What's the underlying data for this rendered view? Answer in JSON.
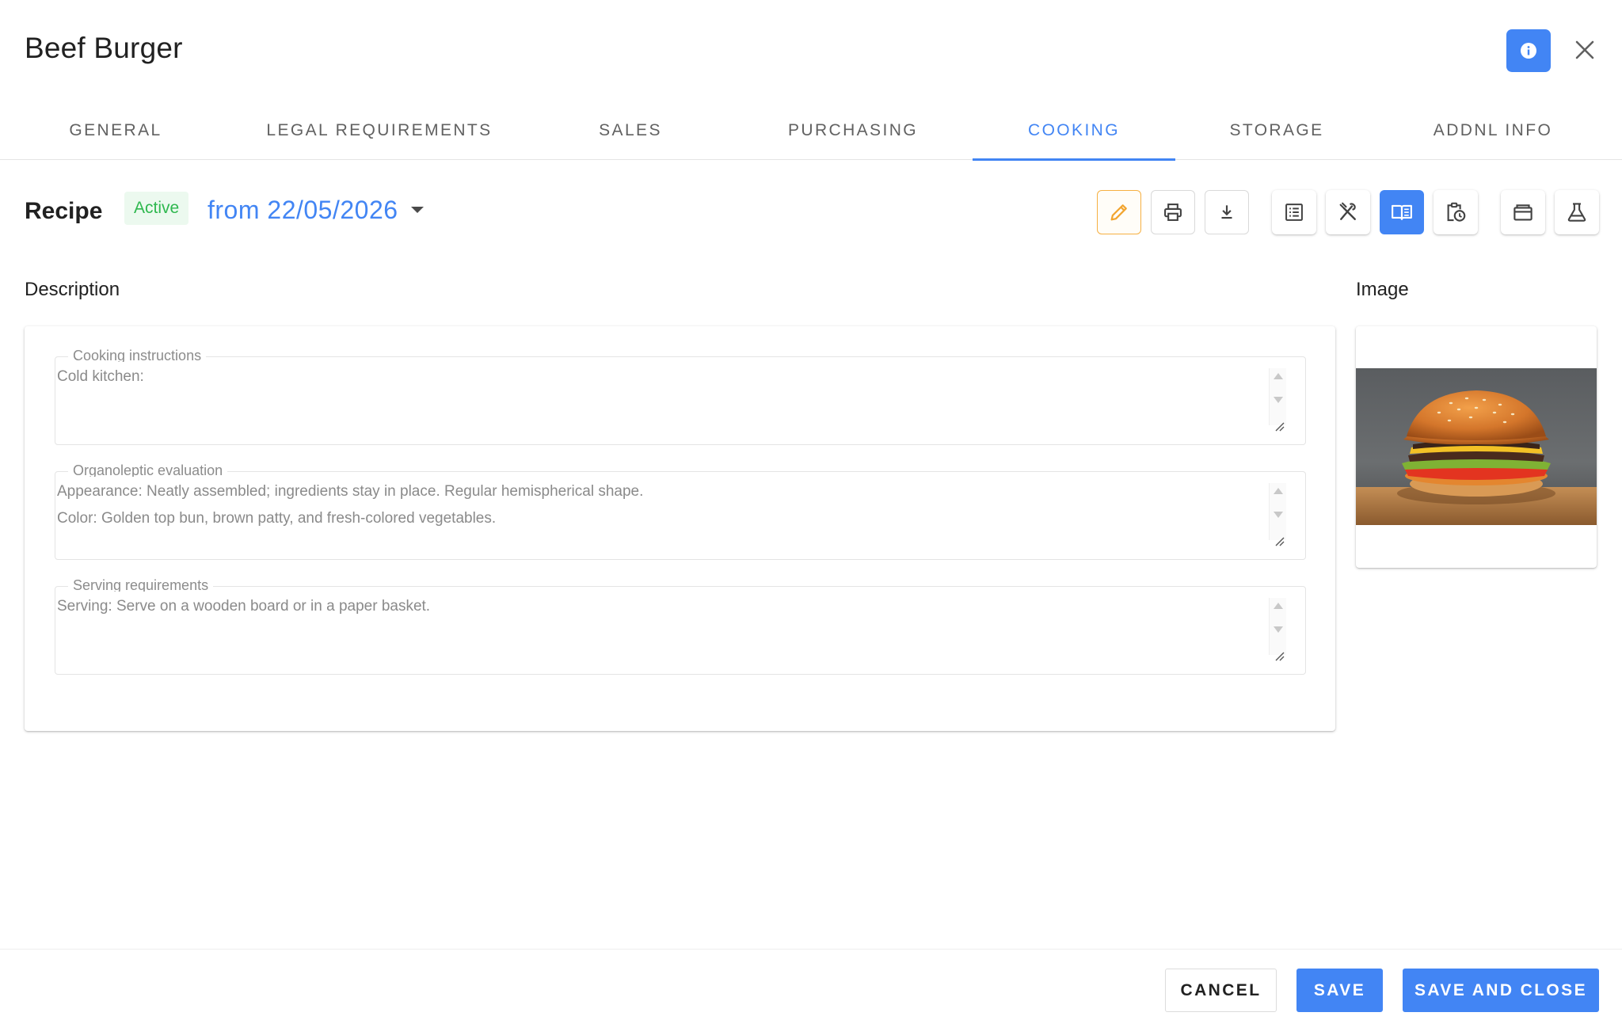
{
  "header": {
    "title": "Beef Burger"
  },
  "tabs": [
    {
      "label": "GENERAL",
      "active": false
    },
    {
      "label": "LEGAL REQUIREMENTS",
      "active": false
    },
    {
      "label": "SALES",
      "active": false
    },
    {
      "label": "PURCHASING",
      "active": false
    },
    {
      "label": "COOKING",
      "active": true
    },
    {
      "label": "STORAGE",
      "active": false
    },
    {
      "label": "ADDNL INFO",
      "active": false
    }
  ],
  "recipe": {
    "label": "Recipe",
    "status": "Active",
    "date": "from 22/05/2026",
    "toolbar": [
      "pencil-icon",
      "print-icon",
      "download-icon",
      "list-icon",
      "cutlery-icon",
      "book-icon",
      "clipboard-clock-icon",
      "box-icon",
      "flask-icon"
    ],
    "active_tool": "book-icon"
  },
  "description": {
    "label": "Description",
    "fields": [
      {
        "legend": "Cooking instructions",
        "lines": [
          "Cold kitchen:"
        ]
      },
      {
        "legend": "Organoleptic evaluation",
        "lines": [
          "Appearance: Neatly assembled; ingredients stay in place. Regular hemispherical shape.",
          "Color: Golden top bun, brown patty, and fresh-colored vegetables."
        ]
      },
      {
        "legend": "Serving requirements",
        "lines": [
          "Serving: Serve on a wooden board or in a paper basket."
        ]
      }
    ]
  },
  "image": {
    "label": "Image"
  },
  "footer": {
    "cancel": "CANCEL",
    "save": "SAVE",
    "save_close": "SAVE AND CLOSE"
  },
  "colors": {
    "accent": "#4285f4",
    "active_badge_text": "#2fb84f",
    "active_badge_bg": "#ecf9ef",
    "edit_outline": "#f6b042"
  }
}
